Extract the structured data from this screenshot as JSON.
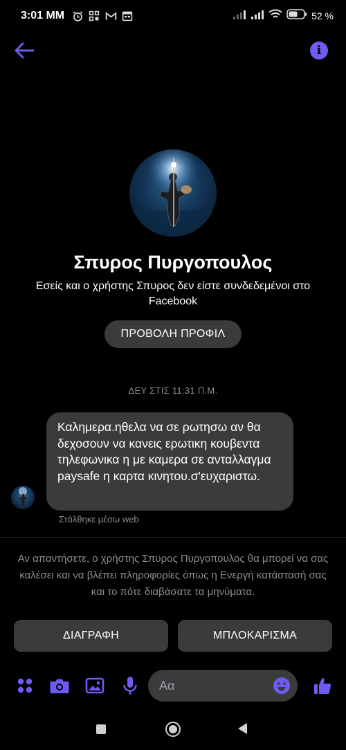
{
  "status_bar": {
    "time": "3:01 ΜΜ",
    "battery_percent": "52",
    "icons_left": [
      "alarm-icon",
      "grid-icon",
      "gmail-icon",
      "calendar-icon"
    ],
    "icons_right": [
      "signal-icon",
      "signal-icon",
      "wifi-icon",
      "battery-icon"
    ]
  },
  "header": {
    "back_icon": "arrow-left-icon",
    "info_icon": "info-icon",
    "accent_color": "#6e5bf2"
  },
  "profile": {
    "name": "Σπυρος Πυργοπουλος",
    "subtitle": "Εσείς και ο χρήστης Σπυρος δεν είστε συνδεδεμένοι στο Facebook",
    "view_profile_label": "ΠΡΟΒΟΛΗ ΠΡΟΦΙΛ"
  },
  "conversation": {
    "timestamp": "ΔΕΥ ΣΤΙΣ 11:31 Π.Μ.",
    "messages": [
      {
        "text": "Καλημερα.ηθελα να σε ρωτησω αν θα δεχοσουν να κανεις ερωτικη κουβεντα τηλεφωνικα η με καμερα σε ανταλλαγμα paysafe η καρτα κινητου.σ'ευχαριστω.",
        "sent_via": "Στάλθηκε μέσω web"
      }
    ]
  },
  "request_notice": {
    "text": "Αν απαντήσετε, ο χρήστης Σπυρος Πυργοπουλος θα μπορεί να σας καλέσει και να βλέπει πληροφορίες όπως η Ενεργή κατάστασή σας και το πότε διαβάσατε τα μηνύματα.",
    "delete_label": "ΔΙΑΓΡΑΦΗ",
    "block_label": "ΜΠΛΟΚΑΡΙΣΜΑ"
  },
  "composer": {
    "placeholder": "Αα",
    "icons": [
      "apps-icon",
      "camera-icon",
      "gallery-icon",
      "microphone-icon",
      "emoji-icon",
      "like-icon"
    ]
  },
  "nav_bar": {
    "icons": [
      "recents-icon",
      "home-icon",
      "back-icon"
    ]
  }
}
